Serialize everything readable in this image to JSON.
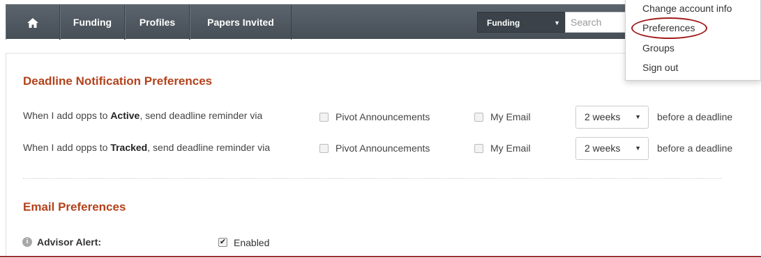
{
  "nav": {
    "home_icon": "home-icon",
    "items": [
      {
        "label": "Funding"
      },
      {
        "label": "Profiles"
      },
      {
        "label": "Papers Invited"
      }
    ],
    "search_scope": "Funding",
    "search_placeholder": "Search"
  },
  "account_menu": {
    "items": [
      {
        "label": "Change account info"
      },
      {
        "label": "Preferences"
      },
      {
        "label": "Groups"
      },
      {
        "label": "Sign out"
      }
    ],
    "highlighted": "Preferences",
    "highlight_color": "#a11a1a"
  },
  "deadline": {
    "title": "Deadline Notification Preferences",
    "rows": [
      {
        "label_prefix": "When I add opps to ",
        "label_bold": "Active",
        "label_suffix": ", send deadline reminder via",
        "option1": "Pivot Announcements",
        "option2": "My Email",
        "timing": "2 weeks",
        "after": "before a deadline"
      },
      {
        "label_prefix": "When I add opps to ",
        "label_bold": "Tracked",
        "label_suffix": ", send deadline reminder via",
        "option1": "Pivot Announcements",
        "option2": "My Email",
        "timing": "2 weeks",
        "after": "before a deadline"
      }
    ]
  },
  "email": {
    "title": "Email Preferences",
    "advisor_label": "Advisor Alert:",
    "advisor_checked": true,
    "advisor_state": "Enabled"
  },
  "colors": {
    "accent": "#b3421c",
    "nav_bg": "#505860"
  }
}
